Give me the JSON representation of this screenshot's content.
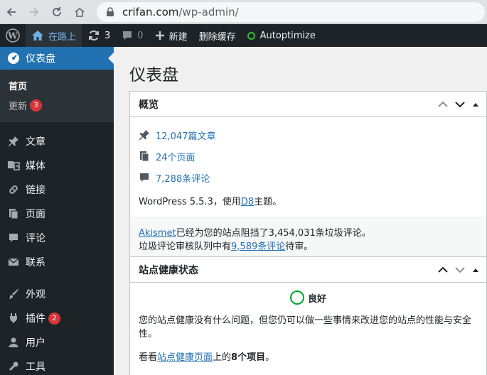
{
  "browser": {
    "url_host": "crifan.com",
    "url_path": "/wp-admin/"
  },
  "adminbar": {
    "site_name": "在路上",
    "updates_count": "3",
    "comments_count": "0",
    "new_label": "新建",
    "clear_cache_label": "删除缓存",
    "autoptimize_label": "Autoptimize"
  },
  "sidebar": {
    "current": {
      "label": "仪表盘"
    },
    "submenu": [
      {
        "label": "首页"
      },
      {
        "label": "更新",
        "badge": "3"
      }
    ],
    "items": [
      {
        "label": "文章"
      },
      {
        "label": "媒体"
      },
      {
        "label": "链接"
      },
      {
        "label": "页面"
      },
      {
        "label": "评论"
      },
      {
        "label": "联系"
      },
      {
        "label": "外观"
      },
      {
        "label": "插件",
        "badge": "2"
      },
      {
        "label": "用户"
      },
      {
        "label": "工具"
      }
    ]
  },
  "main": {
    "title": "仪表盘",
    "overview": {
      "title": "概览",
      "posts": "12,047篇文章",
      "pages": "24个页面",
      "comments": "7,288条评论",
      "wp_prefix": "WordPress 5.5.3，使用",
      "theme": "D8",
      "wp_suffix": "主题。",
      "akismet_link": "Akismet",
      "akismet_text": "已经为您的站点阻挡了3,454,031条垃圾评论。",
      "queue_prefix": "垃圾评论审核队列中有",
      "queue_link": "9,589条评论",
      "queue_suffix": "待审。"
    },
    "health": {
      "title": "站点健康状态",
      "status": "良好",
      "description": "您的站点健康没有什么问题，但您仍可以做一些事情来改进您的站点的性能与安全性。",
      "more_prefix": "看看",
      "more_link": "站点健康页面",
      "more_mid": "上的",
      "more_count": "8个项目",
      "more_suffix": "。"
    }
  }
}
